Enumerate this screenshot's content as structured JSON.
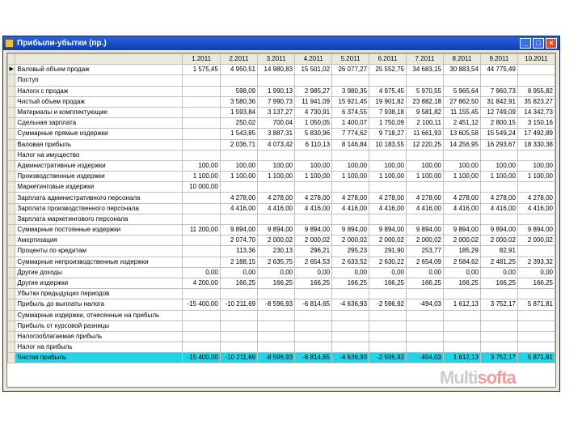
{
  "window": {
    "title": "Прибыли-убытки (пр.)"
  },
  "grid": {
    "headers": [
      "1.2011",
      "2.2011",
      "3.2011",
      "4.2011",
      "5.2011",
      "6.2011",
      "7.2011",
      "8.2011",
      "9.2011",
      "10.2011"
    ],
    "rows": [
      {
        "label": "Валовый объем продаж",
        "values": [
          "1 575,45",
          "4 950,51",
          "14 980,83",
          "15 501,02",
          "26 077,27",
          "25 552,75",
          "34 683,15",
          "30 883,54",
          "44 775,49",
          ""
        ]
      },
      {
        "label": "Поступ",
        "values": [
          "",
          "",
          "",
          "",
          "",
          "",
          "",
          "",
          "",
          ""
        ]
      },
      {
        "label": "Налоги с продаж",
        "values": [
          "",
          "598,09",
          "1 990,13",
          "2 985,27",
          "3 980,35",
          "4 975,45",
          "5 970,55",
          "5 965,64",
          "7 960,73",
          "8 955,82"
        ]
      },
      {
        "label": "Чистый объем продаж",
        "values": [
          "",
          "3 580,36",
          "7 990,73",
          "11 941,09",
          "15 921,45",
          "19 901,82",
          "23 882,18",
          "27 862,50",
          "31 842,91",
          "35 823,27"
        ]
      },
      {
        "label": "Материалы и комплектующие",
        "values": [
          "",
          "1 593,84",
          "3 137,27",
          "4 730,91",
          "6 374,55",
          "7 938,18",
          "9 581,82",
          "11 155,45",
          "12 749,09",
          "14 342,73"
        ]
      },
      {
        "label": "Сдельная зарплата",
        "values": [
          "",
          "250,02",
          "700,04",
          "1 050,05",
          "1 400,07",
          "1 750,09",
          "2 100,11",
          "2 451,12",
          "2 800,15",
          "3 150,16"
        ]
      },
      {
        "label": "Суммарные прямые издержки",
        "values": [
          "",
          "1 543,85",
          "3 887,31",
          "5 830,96",
          "7 774,62",
          "9 718,27",
          "11 661,93",
          "13 605,58",
          "15 549,24",
          "17 492,89"
        ]
      },
      {
        "label": "Валовая прибыль",
        "values": [
          "",
          "2 036,71",
          "4 073,42",
          "6 110,13",
          "8 146,84",
          "10 183,55",
          "12 220,25",
          "14 256,95",
          "16 293,67",
          "18 330,38"
        ]
      },
      {
        "label": "Налог на имущество",
        "values": [
          "",
          "",
          "",
          "",
          "",
          "",
          "",
          "",
          "",
          ""
        ]
      },
      {
        "label": "Административные издержки",
        "values": [
          "100,00",
          "100,00",
          "100,00",
          "100,00",
          "100,00",
          "100,00",
          "100,00",
          "100,00",
          "100,00",
          "100,00"
        ]
      },
      {
        "label": "Производственные издержки",
        "values": [
          "1 100,00",
          "1 100,00",
          "1 100,00",
          "1 100,00",
          "1 100,00",
          "1 100,00",
          "1 100,00",
          "1 100,00",
          "1 100,00",
          "1 100,00"
        ]
      },
      {
        "label": "Маркетинговые издержки",
        "values": [
          "10 000,00",
          "",
          "",
          "",
          "",
          "",
          "",
          "",
          "",
          ""
        ]
      },
      {
        "label": "Зарплата административного персонала",
        "values": [
          "",
          "4 278,00",
          "4 278,00",
          "4 278,00",
          "4 278,00",
          "4 278,00",
          "4 278,00",
          "4 278,00",
          "4 278,00",
          "4 278,00"
        ]
      },
      {
        "label": "Зарплата производственного персонала",
        "values": [
          "",
          "4 416,00",
          "4 416,00",
          "4 416,00",
          "4 416,00",
          "4 416,00",
          "4 416,00",
          "4 416,00",
          "4 416,00",
          "4 416,00"
        ]
      },
      {
        "label": "Зарплата маркетингового персонала",
        "values": [
          "",
          "",
          "",
          "",
          "",
          "",
          "",
          "",
          "",
          ""
        ]
      },
      {
        "label": "Суммарные постоянные издержки",
        "values": [
          "11 200,00",
          "9 894,00",
          "9 894,00",
          "9 894,00",
          "9 894,00",
          "9 894,00",
          "9 894,00",
          "9 894,00",
          "9 894,00",
          "9 894,00"
        ]
      },
      {
        "label": "Амортизация",
        "values": [
          "",
          "2 074,70",
          "2 000,02",
          "2 000,02",
          "2 000,02",
          "2 000,02",
          "2 000,02",
          "2 000,02",
          "2 000,02",
          "2 000,02"
        ]
      },
      {
        "label": "Проценты по кредитам",
        "values": [
          "",
          "113,36",
          "230,13",
          "296,21",
          "295,23",
          "291,90",
          "253,77",
          "185,29",
          "82,91",
          ""
        ]
      },
      {
        "label": "Суммарные непроизводственные издержки",
        "values": [
          "",
          "2 188,15",
          "2 635,75",
          "2 654,53",
          "2 633,52",
          "2 630,22",
          "2 654,09",
          "2 584,62",
          "2 481,25",
          "2 393,32"
        ]
      },
      {
        "label": "Другие доходы",
        "values": [
          "0,00",
          "0,00",
          "0,00",
          "0,00",
          "0,00",
          "0,00",
          "0,00",
          "0,00",
          "0,00",
          "0,00"
        ]
      },
      {
        "label": "Другие издержки",
        "values": [
          "4 200,00",
          "166,25",
          "166,25",
          "166,25",
          "166,25",
          "166,25",
          "166,25",
          "166,25",
          "166,25",
          "166,25"
        ]
      },
      {
        "label": "Убытки предыдущих периодов",
        "values": [
          "",
          "",
          "",
          "",
          "",
          "",
          "",
          "",
          "",
          ""
        ]
      },
      {
        "label": "Прибыль до выплаты налога",
        "values": [
          "-15 400,00",
          "-10 211,69",
          "-8 596,93",
          "-6 814,65",
          "-4 636,93",
          "-2 596,92",
          "-494,03",
          "1 612,13",
          "3 752,17",
          "5 871,81"
        ]
      },
      {
        "label": "Суммарные издержки, отнесенные на прибыль",
        "values": [
          "",
          "",
          "",
          "",
          "",
          "",
          "",
          "",
          "",
          ""
        ]
      },
      {
        "label": "Прибыль от курсовой разницы",
        "values": [
          "",
          "",
          "",
          "",
          "",
          "",
          "",
          "",
          "",
          ""
        ]
      },
      {
        "label": "Налогооблагаемая прибыль",
        "values": [
          "",
          "",
          "",
          "",
          "",
          "",
          "",
          "",
          "",
          ""
        ]
      },
      {
        "label": "Налог на прибыль",
        "values": [
          "",
          "",
          "",
          "",
          "",
          "",
          "",
          "",
          "",
          ""
        ]
      },
      {
        "label": "Чистая прибыль",
        "values": [
          "-15 400,00",
          "-10 211,69",
          "-8 596,93",
          "-6 814,65",
          "-4 636,93",
          "-2 596,92",
          "-494,03",
          "1 612,13",
          "3 752,17",
          "5 871,81"
        ]
      }
    ]
  },
  "watermark": {
    "part1": "Multi",
    "part2": "softa"
  }
}
